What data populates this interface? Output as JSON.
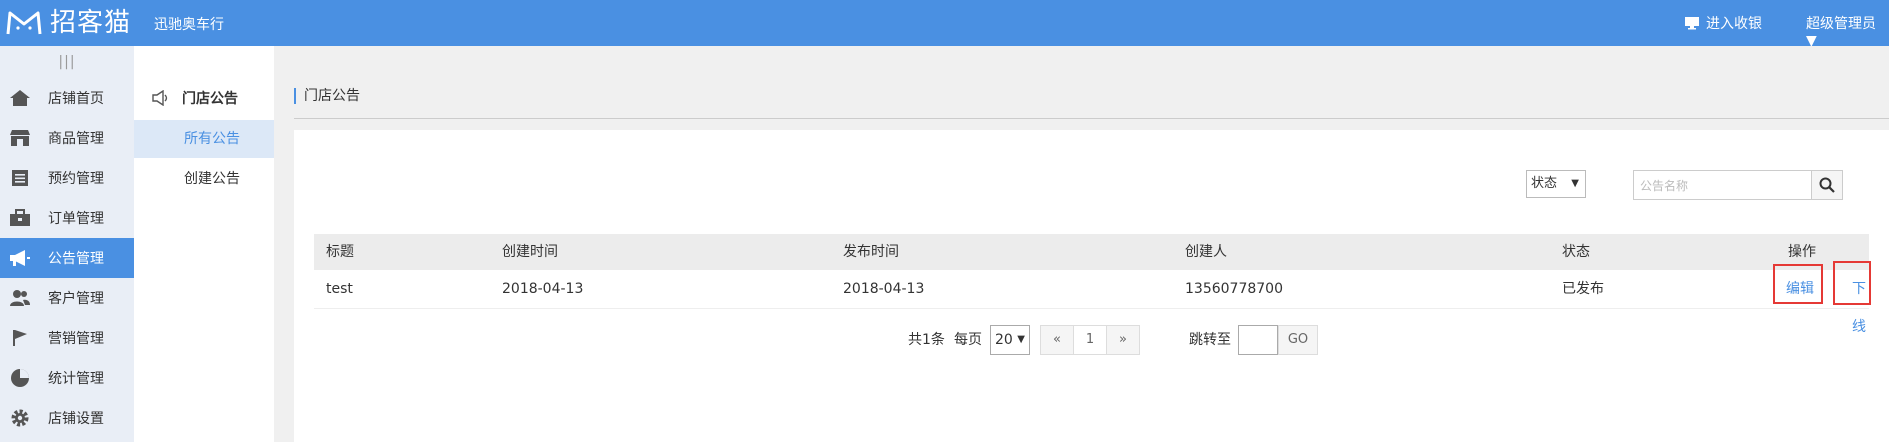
{
  "topbar": {
    "brand": "招客猫",
    "store_name": "迅驰奥车行",
    "cashier_label": "进入收银",
    "admin_label": "超级管理员 ▼"
  },
  "leftnav": {
    "collapse_icon": "|||",
    "items": [
      {
        "label": "店铺首页",
        "icon": "home-icon"
      },
      {
        "label": "商品管理",
        "icon": "store-icon"
      },
      {
        "label": "预约管理",
        "icon": "list-icon"
      },
      {
        "label": "订单管理",
        "icon": "briefcase-icon"
      },
      {
        "label": "公告管理",
        "icon": "megaphone-icon",
        "active": true
      },
      {
        "label": "客户管理",
        "icon": "users-icon"
      },
      {
        "label": "营销管理",
        "icon": "flag-icon"
      },
      {
        "label": "统计管理",
        "icon": "pie-chart-icon"
      },
      {
        "label": "店铺设置",
        "icon": "gear-icon"
      }
    ]
  },
  "subnav": {
    "title": "门店公告",
    "items": [
      {
        "label": "所有公告",
        "active": true
      },
      {
        "label": "创建公告"
      }
    ]
  },
  "content": {
    "breadcrumb": "门店公告",
    "filter": {
      "status_label": "状态",
      "search_placeholder": "公告名称"
    },
    "table": {
      "headers": [
        "标题",
        "创建时间",
        "发布时间",
        "创建人",
        "状态",
        "操作"
      ],
      "rows": [
        {
          "title": "test",
          "created": "2018-04-13",
          "published": "2018-04-13",
          "creator": "13560778700",
          "status": "已发布",
          "actions": [
            "编辑",
            "下线"
          ]
        }
      ]
    },
    "pagination": {
      "total_text": "共1条",
      "per_page_label": "每页",
      "page_size": "20",
      "prev": "«",
      "current_page": "1",
      "next": "»",
      "goto_label": "跳转至",
      "go_label": "GO"
    }
  },
  "colors": {
    "brand_blue": "#4a90e2",
    "highlight_red": "#e53935"
  }
}
